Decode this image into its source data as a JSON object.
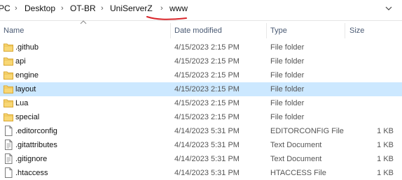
{
  "breadcrumb": {
    "items": [
      "PC",
      "Desktop",
      "OT-BR",
      "UniServerZ",
      "www"
    ],
    "separator": "›"
  },
  "annotation_color": "#d9262b",
  "columns": {
    "name": "Name",
    "date": "Date modified",
    "type": "Type",
    "size": "Size"
  },
  "files": [
    {
      "name": ".github",
      "date": "4/15/2023 2:15 PM",
      "type": "File folder",
      "size": "",
      "icon": "folder-icon"
    },
    {
      "name": "api",
      "date": "4/15/2023 2:15 PM",
      "type": "File folder",
      "size": "",
      "icon": "folder-icon"
    },
    {
      "name": "engine",
      "date": "4/15/2023 2:15 PM",
      "type": "File folder",
      "size": "",
      "icon": "folder-icon"
    },
    {
      "name": "layout",
      "date": "4/15/2023 2:15 PM",
      "type": "File folder",
      "size": "",
      "icon": "folder-icon",
      "selected": true
    },
    {
      "name": "Lua",
      "date": "4/15/2023 2:15 PM",
      "type": "File folder",
      "size": "",
      "icon": "folder-icon"
    },
    {
      "name": "special",
      "date": "4/15/2023 2:15 PM",
      "type": "File folder",
      "size": "",
      "icon": "folder-icon"
    },
    {
      "name": ".editorconfig",
      "date": "4/14/2023 5:31 PM",
      "type": "EDITORCONFIG File",
      "size": "1 KB",
      "icon": "file-icon"
    },
    {
      "name": ".gitattributes",
      "date": "4/14/2023 5:31 PM",
      "type": "Text Document",
      "size": "1 KB",
      "icon": "text-file-icon"
    },
    {
      "name": ".gitignore",
      "date": "4/14/2023 5:31 PM",
      "type": "Text Document",
      "size": "1 KB",
      "icon": "text-file-icon"
    },
    {
      "name": ".htaccess",
      "date": "4/14/2023 5:31 PM",
      "type": "HTACCESS File",
      "size": "1 KB",
      "icon": "file-icon"
    }
  ]
}
